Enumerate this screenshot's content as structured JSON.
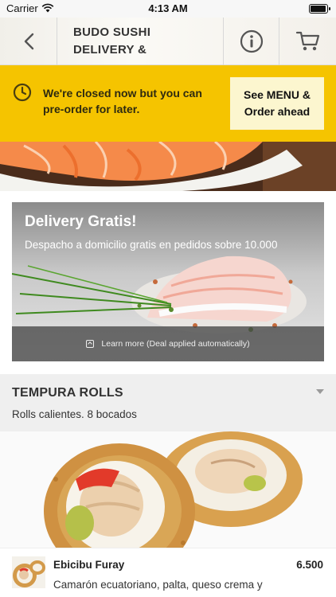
{
  "status_bar": {
    "carrier": "Carrier",
    "time": "4:13 AM",
    "battery_level": 0.95
  },
  "header": {
    "title_line1": "BUDO SUSHI",
    "title_line2": "DELIVERY &",
    "back_icon": "chevron-left-icon",
    "info_icon": "info-icon",
    "cart_icon": "cart-icon"
  },
  "closed_banner": {
    "icon": "clock-icon",
    "message": "We're closed now but you can pre-order for later.",
    "button_line1": "See MENU &",
    "button_line2": "Order ahead",
    "background": "#f5c400",
    "button_background": "#fcf6cf"
  },
  "deal": {
    "title": "Delivery Gratis!",
    "subtitle": "Despacho a domicilio gratis en pedidos sobre 10.000",
    "footer": "Learn more (Deal applied automatically)"
  },
  "category": {
    "title": "TEMPURA ROLLS",
    "subtitle": "Rolls calientes. 8 bocados",
    "chevron_icon": "chevron-down-icon"
  },
  "items": [
    {
      "name": "Ebicibu Furay",
      "price": "6.500",
      "description": "Camarón ecuatoriano, palta, queso crema y"
    }
  ]
}
